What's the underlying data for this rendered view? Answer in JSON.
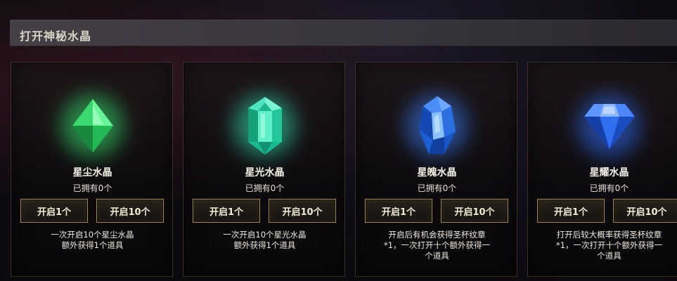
{
  "header": {
    "title": "打开神秘水晶"
  },
  "cards": [
    {
      "name": "星尘水晶",
      "owned": "已拥有0个",
      "open_one_label": "开启1个",
      "open_ten_label": "开启10个",
      "description": "一次开启10个星尘水晶\n额外获得1个道具",
      "icon": "green-gem-icon",
      "color": "#39d86a"
    },
    {
      "name": "星光水晶",
      "owned": "已拥有0个",
      "open_one_label": "开启1个",
      "open_ten_label": "开启10个",
      "description": "一次开启10个星光水晶\n额外获得1个道具",
      "icon": "teal-crystal-icon",
      "color": "#3ad9b0"
    },
    {
      "name": "星魄水晶",
      "owned": "已拥有0个",
      "open_one_label": "开启1个",
      "open_ten_label": "开启10个",
      "description": "开启后有机会获得圣杯纹章\n*1，一次打开十个额外获得一\n个道具",
      "icon": "blue-crystal-icon",
      "color": "#3a7bf0"
    },
    {
      "name": "星耀水晶",
      "owned": "已拥有0个",
      "open_one_label": "开启1个",
      "open_ten_label": "开启10个",
      "description": "打开后较大概率获得圣杯纹章\n*1，一次打开十个额外获得一\n个道具",
      "icon": "blue-diamond-icon",
      "color": "#2f6cf2"
    }
  ]
}
